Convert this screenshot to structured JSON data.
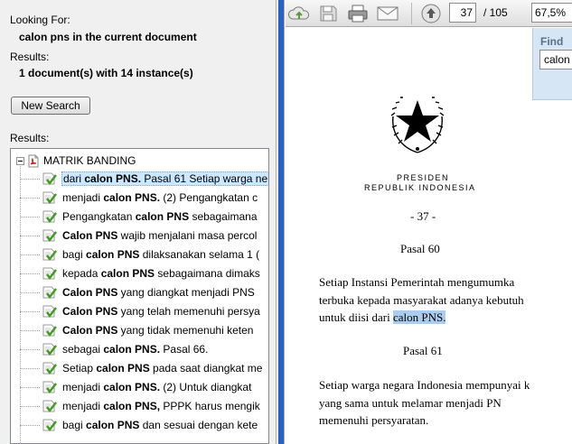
{
  "search_panel": {
    "looking_for_label": "Looking For:",
    "query": "calon pns in the current document",
    "results_label": "Results:",
    "results_summary": "1 document(s) with 14 instance(s)",
    "new_search_label": "New Search",
    "results_list_label": "Results:",
    "document_name": "MATRIK BANDING",
    "results": [
      {
        "pre": "dari ",
        "match": "calon PNS.",
        "post": " Pasal 61 Setiap warga ne"
      },
      {
        "pre": "menjadi ",
        "match": "calon PNS.",
        "post": " (2) Pengangkatan c"
      },
      {
        "pre": "Pengangkatan ",
        "match": "calon PNS",
        "post": " sebagaimana"
      },
      {
        "pre": "",
        "match": "Calon PNS",
        "post": " wajib menjalani masa percol"
      },
      {
        "pre": "bagi ",
        "match": "calon PNS",
        "post": " dilaksanakan selama 1 ("
      },
      {
        "pre": "kepada ",
        "match": "calon PNS",
        "post": " sebagaimana dimaks"
      },
      {
        "pre": "",
        "match": "Calon PNS",
        "post": " yang diangkat menjadi PNS"
      },
      {
        "pre": "",
        "match": "Calon PNS",
        "post": " yang telah memenuhi persya"
      },
      {
        "pre": "",
        "match": "Calon PNS",
        "post": " yang tidak memenuhi keten"
      },
      {
        "pre": "sebagai ",
        "match": "calon PNS.",
        "post": " Pasal 66."
      },
      {
        "pre": "Setiap ",
        "match": "calon PNS",
        "post": " pada saat diangkat me"
      },
      {
        "pre": "menjadi ",
        "match": "calon PNS.",
        "post": " (2) Untuk diangkat"
      },
      {
        "pre": "menjadi ",
        "match": "calon PNS,",
        "post": " PPPK harus mengik"
      },
      {
        "pre": "bagi ",
        "match": "calon PNS",
        "post": " dan sesuai dengan kete"
      }
    ]
  },
  "toolbar": {
    "current_page": "37",
    "page_total": "/ 105",
    "zoom": "67,5%",
    "icons": [
      "upload-cloud-icon",
      "save-disk-icon",
      "print-icon",
      "email-icon",
      "previous-page-icon"
    ]
  },
  "document": {
    "president_line1": "PRESIDEN",
    "president_line2": "REPUBLIK INDONESIA",
    "page_marker": "- 37 -",
    "pasal_60": "Pasal  60",
    "p1_line1": "Setiap  Instansi  Pemerintah  mengumumka",
    "p1_line2": "terbuka kepada masyarakat adanya kebutuh",
    "p1_line3_pre": "untuk diisi dari ",
    "p1_line3_hl": "calon PNS.",
    "pasal_61": "Pasal 61",
    "p2_line1": "Setiap warga negara Indonesia mempunyai k",
    "p2_line2": "yang  sama  untuk  melamar  menjadi  PN",
    "p2_line3": "memenuhi persyaratan."
  },
  "find": {
    "label": "Find",
    "value": "calon"
  },
  "colors": {
    "highlight": "#aaccee",
    "selection": "#cce8ff",
    "splitter": "#2962c4",
    "find_bg": "#d6e6f5"
  }
}
